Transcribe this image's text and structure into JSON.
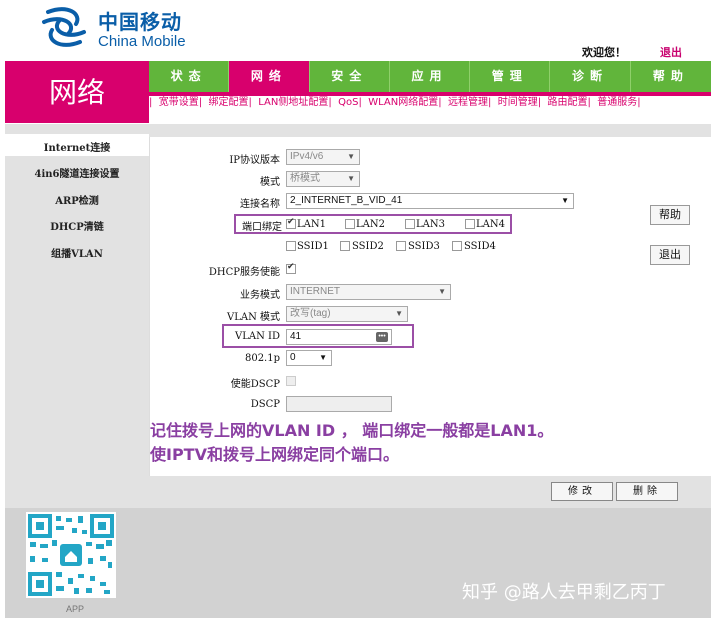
{
  "brand": {
    "name_cn": "中国移动",
    "name_en": "China Mobile",
    "logo_icon": "china-mobile-logo-icon"
  },
  "header": {
    "welcome": "欢迎您！",
    "logout": "退出"
  },
  "section_title": "网络",
  "top_nav": {
    "tabs": [
      {
        "label": "状态",
        "active": false
      },
      {
        "label": "网络",
        "active": true
      },
      {
        "label": "安全",
        "active": false
      },
      {
        "label": "应用",
        "active": false
      },
      {
        "label": "管理",
        "active": false
      },
      {
        "label": "诊断",
        "active": false
      },
      {
        "label": "帮助",
        "active": false
      }
    ]
  },
  "sub_nav": {
    "items": [
      "宽带设置",
      "绑定配置",
      "LAN侧地址配置",
      "QoS",
      "WLAN网络配置",
      "远程管理",
      "时间管理",
      "路由配置",
      "普通服务"
    ]
  },
  "sidebar": {
    "items": [
      "Internet连接",
      "4in6隧道连接设置",
      "ARP检测",
      "DHCP清链",
      "组播VLAN"
    ],
    "active_index": 0
  },
  "form": {
    "ip_version": {
      "label": "IP协议版本",
      "value": "IPv4/v6"
    },
    "mode": {
      "label": "模式",
      "value": "桥模式"
    },
    "connection_name": {
      "label": "连接名称",
      "value": "2_INTERNET_B_VID_41"
    },
    "port_binding": {
      "label": "端口绑定",
      "lan": [
        {
          "label": "LAN1",
          "checked": true
        },
        {
          "label": "LAN2",
          "checked": false
        },
        {
          "label": "LAN3",
          "checked": false
        },
        {
          "label": "LAN4",
          "checked": false
        }
      ],
      "ssid": [
        {
          "label": "SSID1",
          "checked": false
        },
        {
          "label": "SSID2",
          "checked": false
        },
        {
          "label": "SSID3",
          "checked": false
        },
        {
          "label": "SSID4",
          "checked": false
        }
      ]
    },
    "dhcp_enable": {
      "label": "DHCP服务使能",
      "checked": true
    },
    "service_mode": {
      "label": "业务模式",
      "value": "INTERNET"
    },
    "vlan_mode": {
      "label": "VLAN 模式",
      "value": "改写(tag)"
    },
    "vlan_id": {
      "label": "VLAN ID",
      "value": "41",
      "picker_icon": "ellipsis-icon"
    },
    "priority": {
      "label": "802.1p",
      "value": "0"
    },
    "dscp_enable": {
      "label": "使能DSCP",
      "checked": false
    },
    "dscp": {
      "label": "DSCP",
      "value": ""
    }
  },
  "side_buttons": {
    "help": "帮助",
    "logout": "退出"
  },
  "note": {
    "line1": "记住拨号上网的VLAN ID ， 端口绑定一般都是LAN1。",
    "line2": "使IPTV和拨号上网绑定同个端口。"
  },
  "actions": {
    "modify": "修改",
    "delete": "删除"
  },
  "footer": {
    "app_label": "APP",
    "watermark": "知乎 @路人去甲剩乙丙丁",
    "qr_icon": "qr-code-icon"
  },
  "colors": {
    "brand_blue": "#0a5ea8",
    "accent_magenta": "#d8006d",
    "nav_green": "#61b53b",
    "annotation_purple": "#9b4fa6"
  }
}
